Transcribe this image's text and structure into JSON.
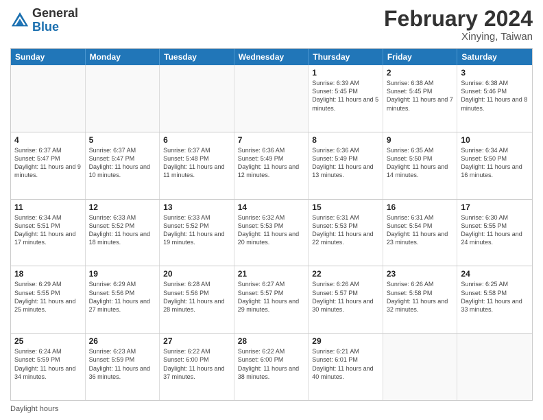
{
  "header": {
    "logo_general": "General",
    "logo_blue": "Blue",
    "month_year": "February 2024",
    "location": "Xinying, Taiwan"
  },
  "calendar": {
    "days_of_week": [
      "Sunday",
      "Monday",
      "Tuesday",
      "Wednesday",
      "Thursday",
      "Friday",
      "Saturday"
    ],
    "weeks": [
      [
        {
          "day": "",
          "empty": true
        },
        {
          "day": "",
          "empty": true
        },
        {
          "day": "",
          "empty": true
        },
        {
          "day": "",
          "empty": true
        },
        {
          "day": "1",
          "sunrise": "6:39 AM",
          "sunset": "5:45 PM",
          "daylight": "11 hours and 5 minutes."
        },
        {
          "day": "2",
          "sunrise": "6:38 AM",
          "sunset": "5:45 PM",
          "daylight": "11 hours and 7 minutes."
        },
        {
          "day": "3",
          "sunrise": "6:38 AM",
          "sunset": "5:46 PM",
          "daylight": "11 hours and 8 minutes."
        }
      ],
      [
        {
          "day": "4",
          "sunrise": "6:37 AM",
          "sunset": "5:47 PM",
          "daylight": "11 hours and 9 minutes."
        },
        {
          "day": "5",
          "sunrise": "6:37 AM",
          "sunset": "5:47 PM",
          "daylight": "11 hours and 10 minutes."
        },
        {
          "day": "6",
          "sunrise": "6:37 AM",
          "sunset": "5:48 PM",
          "daylight": "11 hours and 11 minutes."
        },
        {
          "day": "7",
          "sunrise": "6:36 AM",
          "sunset": "5:49 PM",
          "daylight": "11 hours and 12 minutes."
        },
        {
          "day": "8",
          "sunrise": "6:36 AM",
          "sunset": "5:49 PM",
          "daylight": "11 hours and 13 minutes."
        },
        {
          "day": "9",
          "sunrise": "6:35 AM",
          "sunset": "5:50 PM",
          "daylight": "11 hours and 14 minutes."
        },
        {
          "day": "10",
          "sunrise": "6:34 AM",
          "sunset": "5:50 PM",
          "daylight": "11 hours and 16 minutes."
        }
      ],
      [
        {
          "day": "11",
          "sunrise": "6:34 AM",
          "sunset": "5:51 PM",
          "daylight": "11 hours and 17 minutes."
        },
        {
          "day": "12",
          "sunrise": "6:33 AM",
          "sunset": "5:52 PM",
          "daylight": "11 hours and 18 minutes."
        },
        {
          "day": "13",
          "sunrise": "6:33 AM",
          "sunset": "5:52 PM",
          "daylight": "11 hours and 19 minutes."
        },
        {
          "day": "14",
          "sunrise": "6:32 AM",
          "sunset": "5:53 PM",
          "daylight": "11 hours and 20 minutes."
        },
        {
          "day": "15",
          "sunrise": "6:31 AM",
          "sunset": "5:53 PM",
          "daylight": "11 hours and 22 minutes."
        },
        {
          "day": "16",
          "sunrise": "6:31 AM",
          "sunset": "5:54 PM",
          "daylight": "11 hours and 23 minutes."
        },
        {
          "day": "17",
          "sunrise": "6:30 AM",
          "sunset": "5:55 PM",
          "daylight": "11 hours and 24 minutes."
        }
      ],
      [
        {
          "day": "18",
          "sunrise": "6:29 AM",
          "sunset": "5:55 PM",
          "daylight": "11 hours and 25 minutes."
        },
        {
          "day": "19",
          "sunrise": "6:29 AM",
          "sunset": "5:56 PM",
          "daylight": "11 hours and 27 minutes."
        },
        {
          "day": "20",
          "sunrise": "6:28 AM",
          "sunset": "5:56 PM",
          "daylight": "11 hours and 28 minutes."
        },
        {
          "day": "21",
          "sunrise": "6:27 AM",
          "sunset": "5:57 PM",
          "daylight": "11 hours and 29 minutes."
        },
        {
          "day": "22",
          "sunrise": "6:26 AM",
          "sunset": "5:57 PM",
          "daylight": "11 hours and 30 minutes."
        },
        {
          "day": "23",
          "sunrise": "6:26 AM",
          "sunset": "5:58 PM",
          "daylight": "11 hours and 32 minutes."
        },
        {
          "day": "24",
          "sunrise": "6:25 AM",
          "sunset": "5:58 PM",
          "daylight": "11 hours and 33 minutes."
        }
      ],
      [
        {
          "day": "25",
          "sunrise": "6:24 AM",
          "sunset": "5:59 PM",
          "daylight": "11 hours and 34 minutes."
        },
        {
          "day": "26",
          "sunrise": "6:23 AM",
          "sunset": "5:59 PM",
          "daylight": "11 hours and 36 minutes."
        },
        {
          "day": "27",
          "sunrise": "6:22 AM",
          "sunset": "6:00 PM",
          "daylight": "11 hours and 37 minutes."
        },
        {
          "day": "28",
          "sunrise": "6:22 AM",
          "sunset": "6:00 PM",
          "daylight": "11 hours and 38 minutes."
        },
        {
          "day": "29",
          "sunrise": "6:21 AM",
          "sunset": "6:01 PM",
          "daylight": "11 hours and 40 minutes."
        },
        {
          "day": "",
          "empty": true
        },
        {
          "day": "",
          "empty": true
        }
      ]
    ]
  },
  "footer": {
    "daylight_label": "Daylight hours"
  }
}
